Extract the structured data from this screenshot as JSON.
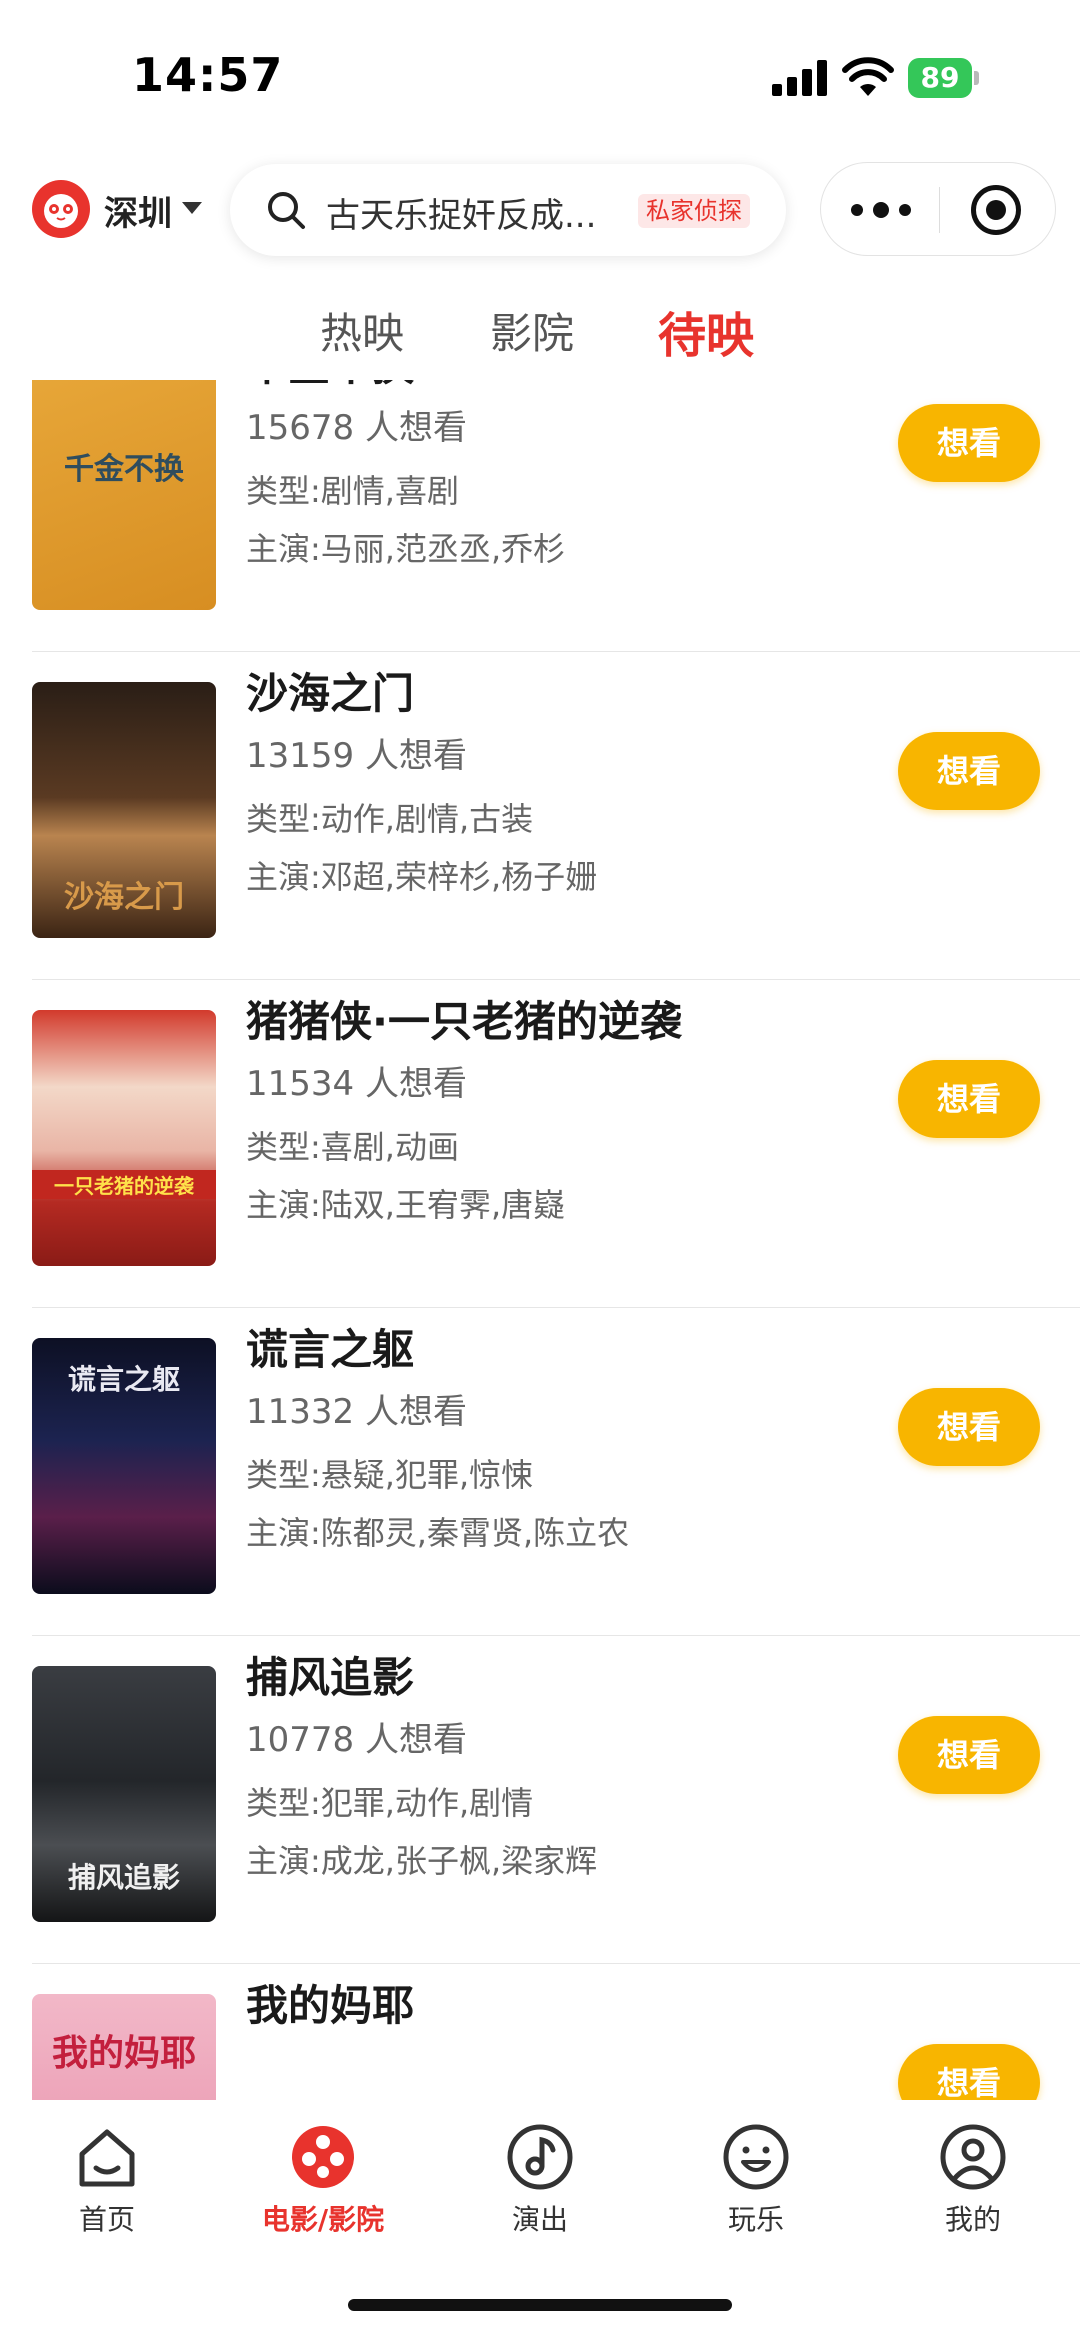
{
  "status": {
    "time": "14:57",
    "battery": "89"
  },
  "header": {
    "city": "深圳",
    "search_text": "古天乐捉奸反成...",
    "search_tag": "私家侦探"
  },
  "tabs": [
    {
      "label": "热映",
      "active": false
    },
    {
      "label": "影院",
      "active": false
    },
    {
      "label": "待映",
      "active": true
    }
  ],
  "movies": [
    {
      "title": "千金不换",
      "want": "15678 人想看",
      "genre": "类型:剧情,喜剧",
      "cast": "主演:马丽,范丞丞,乔杉",
      "button": "想看",
      "poster_text": "千金不换"
    },
    {
      "title": "沙海之门",
      "want": "13159 人想看",
      "genre": "类型:动作,剧情,古装",
      "cast": "主演:邓超,荣梓杉,杨子姗",
      "button": "想看",
      "poster_text": "沙海之门"
    },
    {
      "title": "猪猪侠·一只老猪的逆袭",
      "want": "11534 人想看",
      "genre": "类型:喜剧,动画",
      "cast": "主演:陆双,王宥霁,唐嶷",
      "button": "想看",
      "poster_text": "一只老猪的逆袭"
    },
    {
      "title": "谎言之躯",
      "want": "11332 人想看",
      "genre": "类型:悬疑,犯罪,惊悚",
      "cast": "主演:陈都灵,秦霄贤,陈立农",
      "button": "想看",
      "poster_text": "谎言之躯"
    },
    {
      "title": "捕风追影",
      "want": "10778 人想看",
      "genre": "类型:犯罪,动作,剧情",
      "cast": "主演:成龙,张子枫,梁家辉",
      "button": "想看",
      "poster_text": "捕风追影"
    },
    {
      "title": "我的妈耶",
      "want": "",
      "genre": "",
      "cast": "",
      "button": "想看",
      "poster_text": "我的妈耶"
    }
  ],
  "tabbar": [
    {
      "label": "首页",
      "icon": "home-icon",
      "active": false
    },
    {
      "label": "电影/影院",
      "icon": "film-reel-icon",
      "active": true
    },
    {
      "label": "演出",
      "icon": "music-note-icon",
      "active": false
    },
    {
      "label": "玩乐",
      "icon": "smile-icon",
      "active": false
    },
    {
      "label": "我的",
      "icon": "user-icon",
      "active": false
    }
  ],
  "colors": {
    "accent": "#e8332d",
    "want_button": "#f8b500"
  }
}
